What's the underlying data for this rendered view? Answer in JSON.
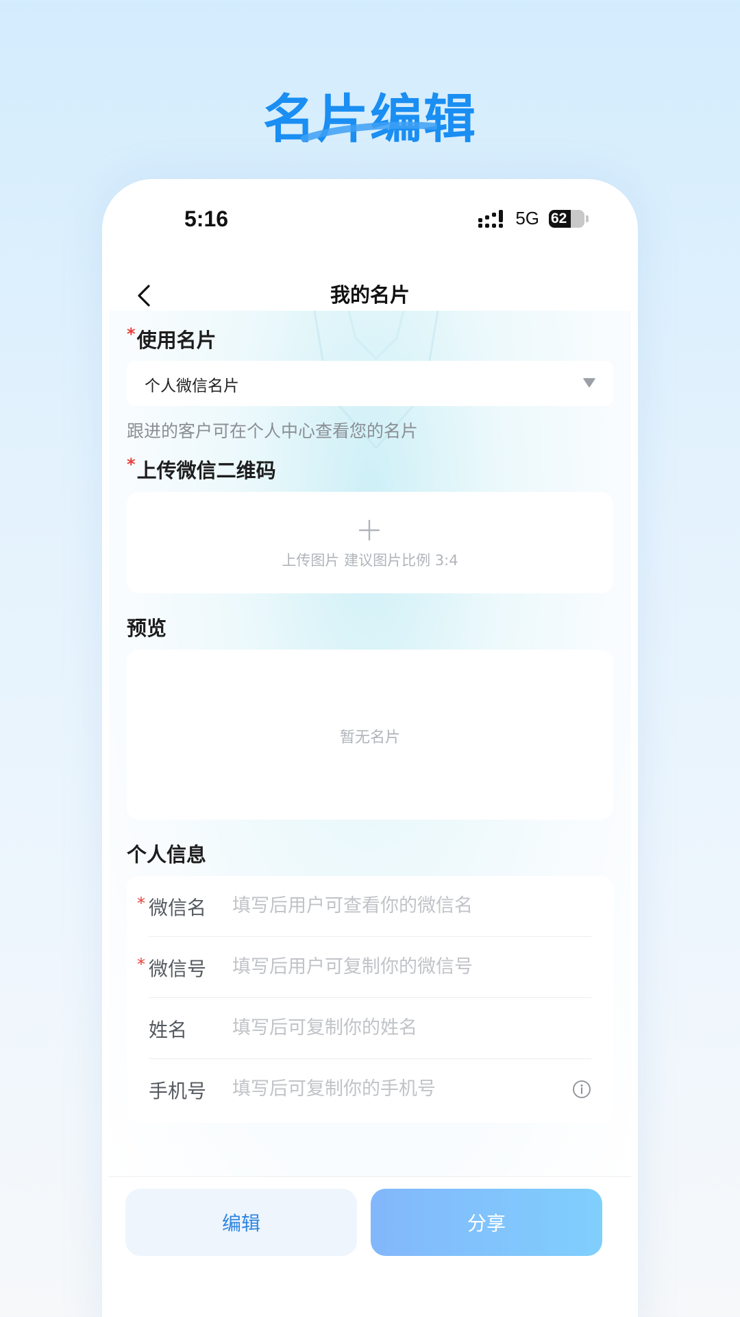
{
  "hero": {
    "title": "名片编辑"
  },
  "status_bar": {
    "time": "5:16",
    "network": "5G",
    "battery": "62",
    "battery_level": 0.62
  },
  "nav": {
    "title": "我的名片"
  },
  "form": {
    "card_type": {
      "required_mark": "*",
      "label": "使用名片",
      "selected_value": "个人微信名片",
      "hint": "跟进的客户可在个人中心查看您的名片"
    },
    "qr_upload": {
      "required_mark": "*",
      "label": "上传微信二维码",
      "upload_text": "上传图片 建议图片比例 3:4"
    },
    "preview": {
      "label": "预览",
      "empty_text": "暂无名片"
    },
    "personal_info": {
      "label": "个人信息",
      "fields": [
        {
          "required_mark": "*",
          "label": "微信名",
          "placeholder": "填写后用户可查看你的微信名",
          "value": ""
        },
        {
          "required_mark": "*",
          "label": "微信号",
          "placeholder": "填写后用户可复制你的微信号",
          "value": ""
        },
        {
          "required_mark": "",
          "label": "姓名",
          "placeholder": "填写后可复制你的姓名",
          "value": ""
        },
        {
          "required_mark": "",
          "label": "手机号",
          "placeholder": "填写后可复制你的手机号",
          "value": ""
        }
      ]
    }
  },
  "footer": {
    "edit_label": "编辑",
    "share_label": "分享"
  },
  "colors": {
    "accent": "#1a8ef2",
    "required": "#e8403a",
    "share_gradient_start": "#82b7fb",
    "share_gradient_end": "#80cffd",
    "edit_bg": "#eef5fd"
  }
}
